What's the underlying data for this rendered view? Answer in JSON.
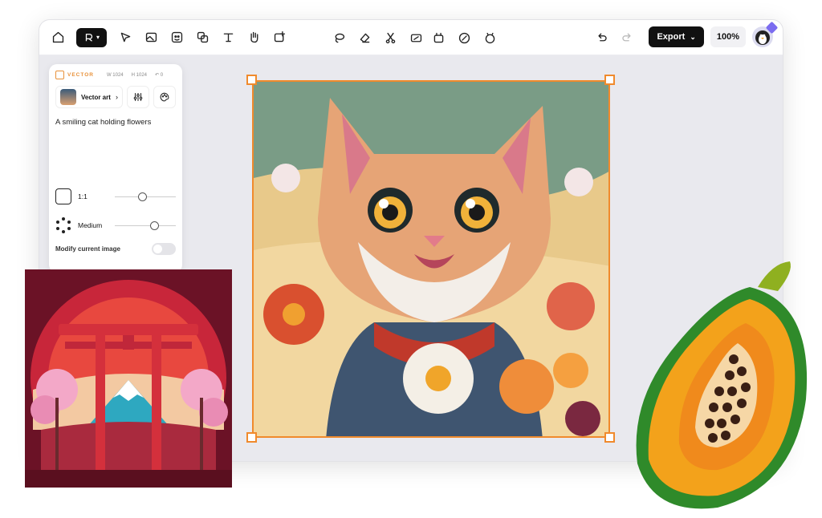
{
  "toolbar": {
    "tools": [
      "home-icon",
      "logo-menu",
      "select-icon",
      "image-icon",
      "face-icon",
      "layers-icon",
      "text-icon",
      "hand-icon",
      "image-add-icon"
    ],
    "ai_tools": [
      "lasso-icon",
      "eraser-icon",
      "scissors-icon",
      "resize-icon"
    ],
    "ai_tools2": [
      "upscale-icon",
      "edit-icon",
      "magic-icon"
    ],
    "export_label": "Export",
    "zoom": "100%"
  },
  "panel": {
    "title": "VECTOR",
    "width_label": "W 1024",
    "height_label": "H 1024",
    "rotation_label": "0",
    "style_name": "Vector art",
    "prompt": "A smiling cat holding flowers",
    "ratio_label": "1:1",
    "ratio_level": 0.45,
    "quality_label": "Medium",
    "quality_level": 0.65,
    "modify_label": "Modify current image",
    "modify_enabled": false
  },
  "colors": {
    "accent": "#f08a2c",
    "dark": "#111111"
  }
}
